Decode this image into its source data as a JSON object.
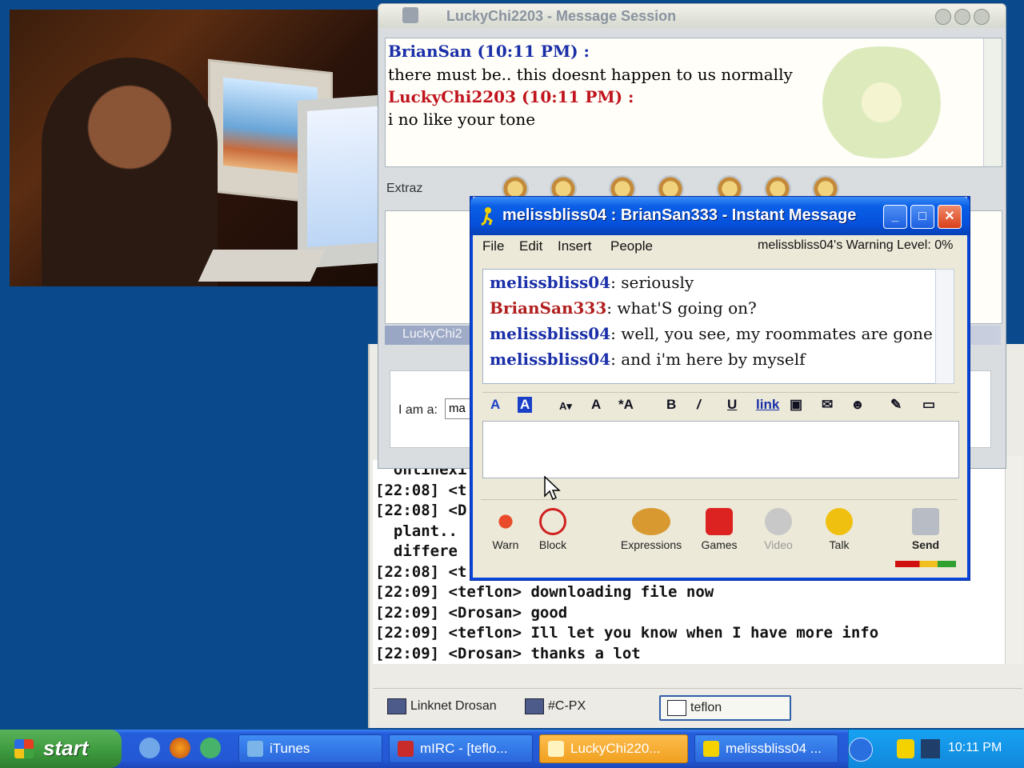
{
  "mirc": {
    "log_lines": [
      "  onlinexi",
      "[22:08] <t",
      "[22:08] <D",
      "  plant..",
      "  differe",
      "[22:08] <t",
      "[22:09] <teflon> downloading file now",
      "[22:09] <Drosan> good",
      "[22:09] <teflon> Ill let you know when I have more info",
      "[22:09] <Drosan> thanks a lot"
    ],
    "switchbar": [
      "Linknet Drosan",
      "#C-PX",
      "teflon"
    ]
  },
  "message_session": {
    "title": "LuckyChi2203 - Message Session",
    "messages": [
      {
        "name": "BrianSan (10:11 PM) :",
        "text": "there must be.. this doesnt happen to us normally",
        "color": "#1a2fa8"
      },
      {
        "name": "LuckyChi2203 (10:11 PM) :",
        "text": "i no like your tone",
        "color": "#c0141e"
      }
    ],
    "extras_label": "Extraz",
    "footer_label": "LuckyChi2",
    "iam_label": "I am a:",
    "iam_value": "ma"
  },
  "aim": {
    "title": "melissbliss04 : BrianSan333 - Instant Message",
    "menu": [
      "File",
      "Edit",
      "Insert",
      "People"
    ],
    "warning": "melissbliss04's Warning Level: 0%",
    "messages": [
      {
        "sn": "melissbliss04",
        "text": ": seriously",
        "color": "#1a2fa8"
      },
      {
        "sn": "BrianSan333",
        "text": ": what'S going on?",
        "color": "#b21e1e"
      },
      {
        "sn": "melissbliss04",
        "text": ": well, you see, my roommates are gone",
        "color": "#1a2fa8"
      },
      {
        "sn": "melissbliss04",
        "text": ": and i'm here by myself",
        "color": "#1a2fa8"
      }
    ],
    "format_link": "link",
    "actions": [
      "Warn",
      "Block",
      "Expressions",
      "Games",
      "Video",
      "Talk",
      "Send"
    ]
  },
  "taskbar": {
    "start": "start",
    "tasks": [
      "iTunes",
      "mIRC - [teflo...",
      "LuckyChi220...",
      "melissbliss04 ..."
    ],
    "clock": "10:11 PM"
  }
}
